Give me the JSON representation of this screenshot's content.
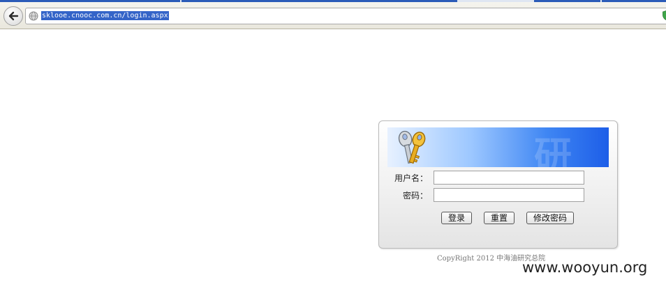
{
  "browser": {
    "url": "sklooe.cnooc.com.cn/login.aspx"
  },
  "login": {
    "username_label": "用户名：",
    "password_label": "密码：",
    "username_value": "",
    "password_value": "",
    "login_button": "登录",
    "reset_button": "重置",
    "change_password_button": "修改密码"
  },
  "footer": {
    "copyright": "CopyRight 2012 中海油研究总院"
  },
  "watermark": "www.wooyun.org",
  "colors": {
    "url_highlight": "#3464c8",
    "banner_blue": "#1d5ee8",
    "tab_strip": "#2b5bb8"
  }
}
